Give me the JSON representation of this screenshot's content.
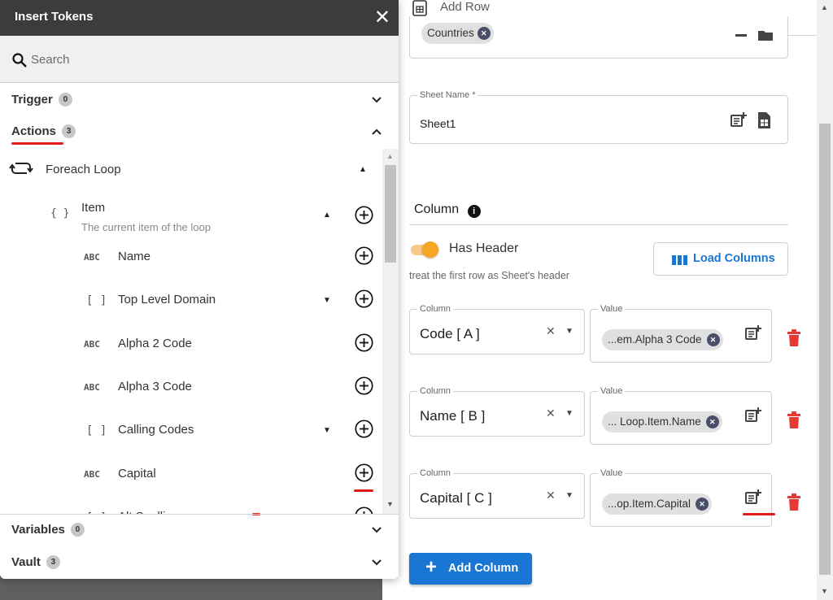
{
  "dialog": {
    "title": "Insert Tokens",
    "close_glyph": "✕",
    "search_placeholder": "Search",
    "sections": [
      {
        "label": "Trigger",
        "count": "0",
        "expanded": false
      },
      {
        "label": "Actions",
        "count": "3",
        "expanded": true
      },
      {
        "label": "Variables",
        "count": "0",
        "expanded": false
      },
      {
        "label": "Vault",
        "count": "3",
        "expanded": false
      }
    ],
    "tree": {
      "foreach_label": "Foreach Loop",
      "item_label": "Item",
      "item_desc": "The current item of the loop",
      "item_type": "{ }",
      "rows": [
        {
          "type": "ABC",
          "label": "Name"
        },
        {
          "type": "[ ]",
          "label": "Top Level Domain"
        },
        {
          "type": "ABC",
          "label": "Alpha 2 Code"
        },
        {
          "type": "ABC",
          "label": "Alpha 3 Code"
        },
        {
          "type": "[ ]",
          "label": "Calling Codes"
        },
        {
          "type": "ABC",
          "label": "Capital"
        },
        {
          "type": "[ ]",
          "label": "Alt Spellings"
        }
      ]
    }
  },
  "right": {
    "add_row_label": "Add Row",
    "top_chip": "Countries",
    "sheet_name_label": "Sheet Name *",
    "sheet_name_value": "Sheet1",
    "column_title": "Column",
    "has_header_label": "Has Header",
    "has_header_desc": "treat the first row as Sheet's header",
    "load_columns_label": "Load Columns",
    "column_rows": [
      {
        "column_label": "Column",
        "column_value": "Code [ A ]",
        "value_label": "Value",
        "value_chip": "...em.Alpha 3 Code"
      },
      {
        "column_label": "Column",
        "column_value": "Name [ B ]",
        "value_label": "Value",
        "value_chip": "... Loop.Item.Name"
      },
      {
        "column_label": "Column",
        "column_value": "Capital [ C ]",
        "value_label": "Value",
        "value_chip": "...op.Item.Capital"
      }
    ],
    "add_column_label": "Add Column"
  },
  "colors": {
    "accent_blue": "#1976d2",
    "toggle_orange": "#f5a623",
    "trash_red": "#e53935",
    "annotation_red": "#e01b1b",
    "header_dark": "#3c3c3c"
  }
}
